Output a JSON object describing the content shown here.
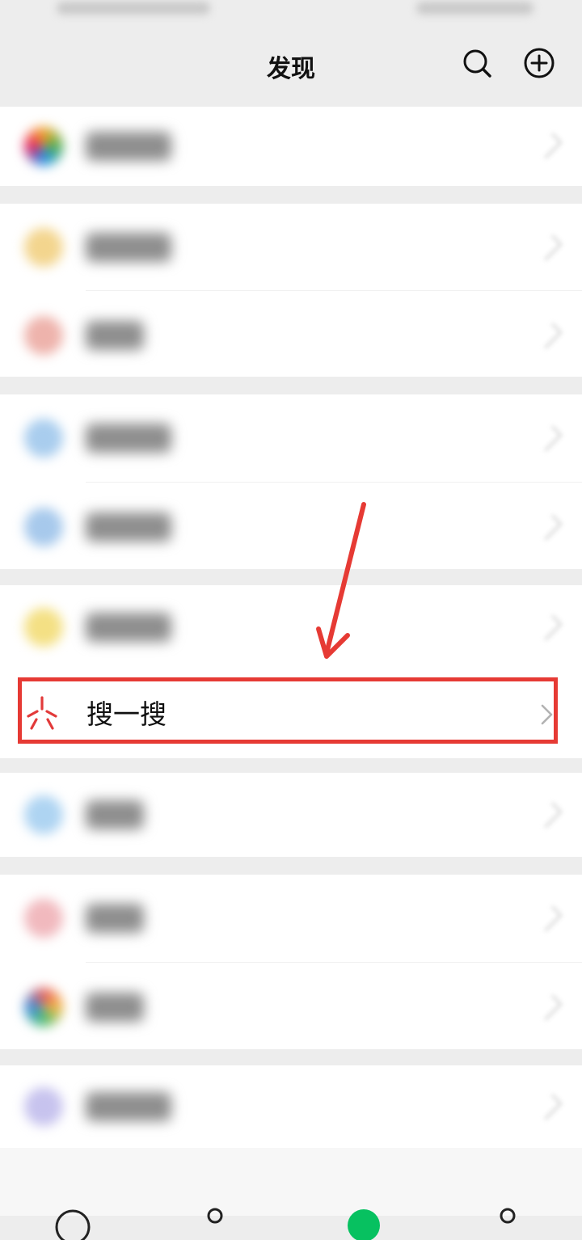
{
  "nav": {
    "title": "发现",
    "search_icon": "search-icon",
    "add_icon": "plus-circle-icon"
  },
  "highlighted_item": {
    "label": "搜一搜",
    "icon": "sousou-icon",
    "accent_color": "#e63a34"
  },
  "annotation": {
    "arrow_color": "#e63a34",
    "box_color": "#e63a34"
  },
  "colors": {
    "background": "#ededed",
    "row_background": "#ffffff",
    "text": "#111111"
  }
}
